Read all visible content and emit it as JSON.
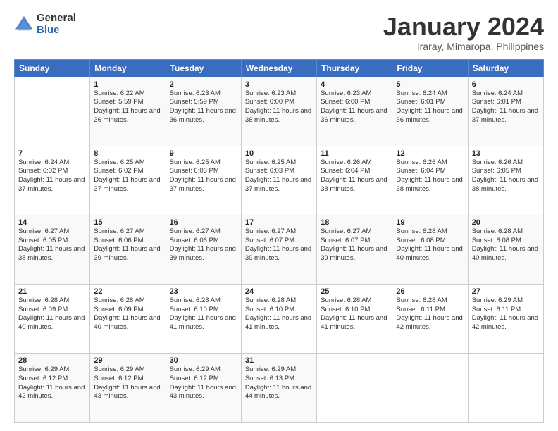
{
  "logo": {
    "general": "General",
    "blue": "Blue"
  },
  "title": {
    "month": "January 2024",
    "location": "Iraray, Mimaropa, Philippines"
  },
  "weekdays": [
    "Sunday",
    "Monday",
    "Tuesday",
    "Wednesday",
    "Thursday",
    "Friday",
    "Saturday"
  ],
  "weeks": [
    [
      {
        "day": "",
        "sunrise": "",
        "sunset": "",
        "daylight": ""
      },
      {
        "day": "1",
        "sunrise": "Sunrise: 6:22 AM",
        "sunset": "Sunset: 5:59 PM",
        "daylight": "Daylight: 11 hours and 36 minutes."
      },
      {
        "day": "2",
        "sunrise": "Sunrise: 6:23 AM",
        "sunset": "Sunset: 5:59 PM",
        "daylight": "Daylight: 11 hours and 36 minutes."
      },
      {
        "day": "3",
        "sunrise": "Sunrise: 6:23 AM",
        "sunset": "Sunset: 6:00 PM",
        "daylight": "Daylight: 11 hours and 36 minutes."
      },
      {
        "day": "4",
        "sunrise": "Sunrise: 6:23 AM",
        "sunset": "Sunset: 6:00 PM",
        "daylight": "Daylight: 11 hours and 36 minutes."
      },
      {
        "day": "5",
        "sunrise": "Sunrise: 6:24 AM",
        "sunset": "Sunset: 6:01 PM",
        "daylight": "Daylight: 11 hours and 36 minutes."
      },
      {
        "day": "6",
        "sunrise": "Sunrise: 6:24 AM",
        "sunset": "Sunset: 6:01 PM",
        "daylight": "Daylight: 11 hours and 37 minutes."
      }
    ],
    [
      {
        "day": "7",
        "sunrise": "Sunrise: 6:24 AM",
        "sunset": "Sunset: 6:02 PM",
        "daylight": "Daylight: 11 hours and 37 minutes."
      },
      {
        "day": "8",
        "sunrise": "Sunrise: 6:25 AM",
        "sunset": "Sunset: 6:02 PM",
        "daylight": "Daylight: 11 hours and 37 minutes."
      },
      {
        "day": "9",
        "sunrise": "Sunrise: 6:25 AM",
        "sunset": "Sunset: 6:03 PM",
        "daylight": "Daylight: 11 hours and 37 minutes."
      },
      {
        "day": "10",
        "sunrise": "Sunrise: 6:25 AM",
        "sunset": "Sunset: 6:03 PM",
        "daylight": "Daylight: 11 hours and 37 minutes."
      },
      {
        "day": "11",
        "sunrise": "Sunrise: 6:26 AM",
        "sunset": "Sunset: 6:04 PM",
        "daylight": "Daylight: 11 hours and 38 minutes."
      },
      {
        "day": "12",
        "sunrise": "Sunrise: 6:26 AM",
        "sunset": "Sunset: 6:04 PM",
        "daylight": "Daylight: 11 hours and 38 minutes."
      },
      {
        "day": "13",
        "sunrise": "Sunrise: 6:26 AM",
        "sunset": "Sunset: 6:05 PM",
        "daylight": "Daylight: 11 hours and 38 minutes."
      }
    ],
    [
      {
        "day": "14",
        "sunrise": "Sunrise: 6:27 AM",
        "sunset": "Sunset: 6:05 PM",
        "daylight": "Daylight: 11 hours and 38 minutes."
      },
      {
        "day": "15",
        "sunrise": "Sunrise: 6:27 AM",
        "sunset": "Sunset: 6:06 PM",
        "daylight": "Daylight: 11 hours and 39 minutes."
      },
      {
        "day": "16",
        "sunrise": "Sunrise: 6:27 AM",
        "sunset": "Sunset: 6:06 PM",
        "daylight": "Daylight: 11 hours and 39 minutes."
      },
      {
        "day": "17",
        "sunrise": "Sunrise: 6:27 AM",
        "sunset": "Sunset: 6:07 PM",
        "daylight": "Daylight: 11 hours and 39 minutes."
      },
      {
        "day": "18",
        "sunrise": "Sunrise: 6:27 AM",
        "sunset": "Sunset: 6:07 PM",
        "daylight": "Daylight: 11 hours and 39 minutes."
      },
      {
        "day": "19",
        "sunrise": "Sunrise: 6:28 AM",
        "sunset": "Sunset: 6:08 PM",
        "daylight": "Daylight: 11 hours and 40 minutes."
      },
      {
        "day": "20",
        "sunrise": "Sunrise: 6:28 AM",
        "sunset": "Sunset: 6:08 PM",
        "daylight": "Daylight: 11 hours and 40 minutes."
      }
    ],
    [
      {
        "day": "21",
        "sunrise": "Sunrise: 6:28 AM",
        "sunset": "Sunset: 6:09 PM",
        "daylight": "Daylight: 11 hours and 40 minutes."
      },
      {
        "day": "22",
        "sunrise": "Sunrise: 6:28 AM",
        "sunset": "Sunset: 6:09 PM",
        "daylight": "Daylight: 11 hours and 40 minutes."
      },
      {
        "day": "23",
        "sunrise": "Sunrise: 6:28 AM",
        "sunset": "Sunset: 6:10 PM",
        "daylight": "Daylight: 11 hours and 41 minutes."
      },
      {
        "day": "24",
        "sunrise": "Sunrise: 6:28 AM",
        "sunset": "Sunset: 6:10 PM",
        "daylight": "Daylight: 11 hours and 41 minutes."
      },
      {
        "day": "25",
        "sunrise": "Sunrise: 6:28 AM",
        "sunset": "Sunset: 6:10 PM",
        "daylight": "Daylight: 11 hours and 41 minutes."
      },
      {
        "day": "26",
        "sunrise": "Sunrise: 6:28 AM",
        "sunset": "Sunset: 6:11 PM",
        "daylight": "Daylight: 11 hours and 42 minutes."
      },
      {
        "day": "27",
        "sunrise": "Sunrise: 6:29 AM",
        "sunset": "Sunset: 6:11 PM",
        "daylight": "Daylight: 11 hours and 42 minutes."
      }
    ],
    [
      {
        "day": "28",
        "sunrise": "Sunrise: 6:29 AM",
        "sunset": "Sunset: 6:12 PM",
        "daylight": "Daylight: 11 hours and 42 minutes."
      },
      {
        "day": "29",
        "sunrise": "Sunrise: 6:29 AM",
        "sunset": "Sunset: 6:12 PM",
        "daylight": "Daylight: 11 hours and 43 minutes."
      },
      {
        "day": "30",
        "sunrise": "Sunrise: 6:29 AM",
        "sunset": "Sunset: 6:12 PM",
        "daylight": "Daylight: 11 hours and 43 minutes."
      },
      {
        "day": "31",
        "sunrise": "Sunrise: 6:29 AM",
        "sunset": "Sunset: 6:13 PM",
        "daylight": "Daylight: 11 hours and 44 minutes."
      },
      {
        "day": "",
        "sunrise": "",
        "sunset": "",
        "daylight": ""
      },
      {
        "day": "",
        "sunrise": "",
        "sunset": "",
        "daylight": ""
      },
      {
        "day": "",
        "sunrise": "",
        "sunset": "",
        "daylight": ""
      }
    ]
  ]
}
